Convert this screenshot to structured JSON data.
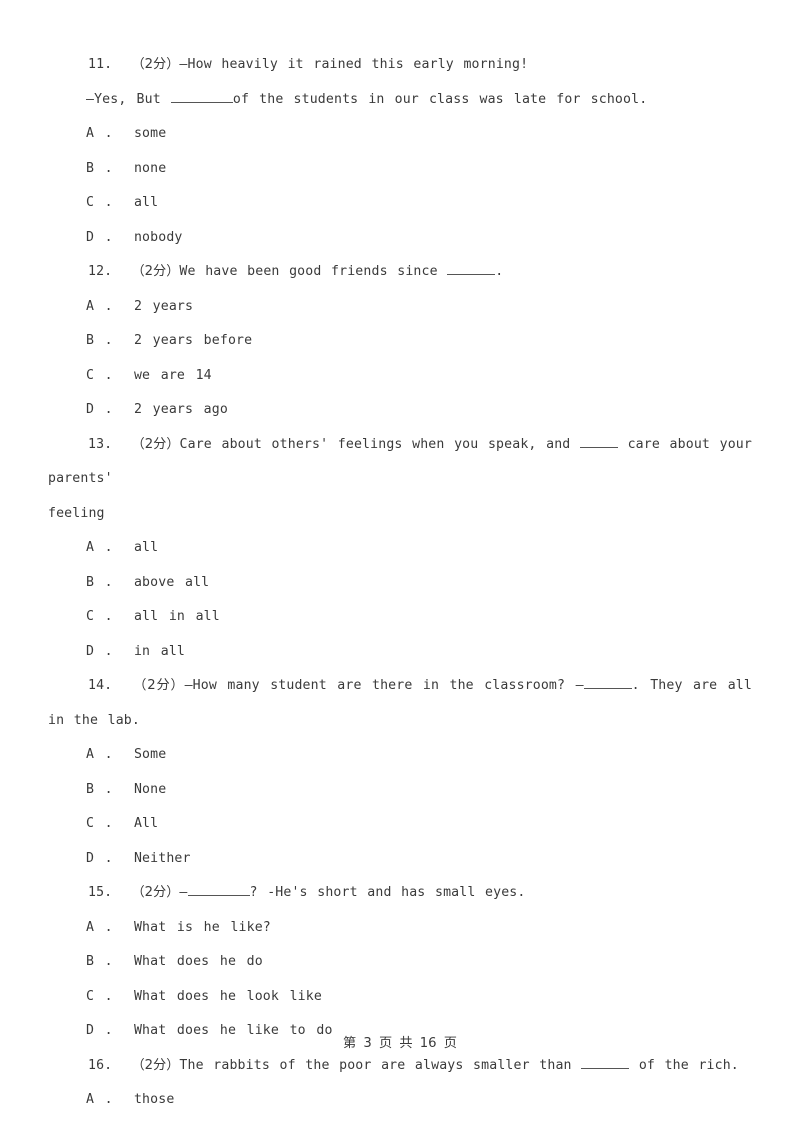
{
  "document": {
    "type": "exam-worksheet",
    "language": "en-zh",
    "score_marker": "（2分）",
    "footer": {
      "text": "第 3 页 共 16 页",
      "prefix": "第",
      "current_page": "3",
      "middle": "页 共",
      "total_pages": "16",
      "suffix": "页"
    }
  },
  "questions": [
    {
      "number": "11.",
      "score": "（2分）",
      "stem": "—How heavily it rained this early morning!",
      "reply_prefix": "—Yes, But ",
      "reply_suffix": "of the students in our class was late for school.",
      "options": [
        {
          "letter": "A",
          "text": "some"
        },
        {
          "letter": "B",
          "text": "none"
        },
        {
          "letter": "C",
          "text": "all"
        },
        {
          "letter": "D",
          "text": "nobody"
        }
      ]
    },
    {
      "number": "12.",
      "score": "（2分）",
      "stem_prefix": "We have been good friends since ",
      "stem_suffix": ".",
      "options": [
        {
          "letter": "A",
          "text": "2 years"
        },
        {
          "letter": "B",
          "text": "2 years before"
        },
        {
          "letter": "C",
          "text": "we are 14"
        },
        {
          "letter": "D",
          "text": "2 years ago"
        }
      ]
    },
    {
      "number": "13.",
      "score": "（2分）",
      "stem_prefix": "Care about others' feelings when you speak, and ",
      "stem_suffix": " care about your parents'",
      "stem_continuation": "feeling",
      "options": [
        {
          "letter": "A",
          "text": "all"
        },
        {
          "letter": "B",
          "text": "above all"
        },
        {
          "letter": "C",
          "text": "all in all"
        },
        {
          "letter": "D",
          "text": "in all"
        }
      ]
    },
    {
      "number": "14.",
      "score": "（2分）",
      "stem_prefix": "—How many student are there in the classroom? —",
      "stem_suffix": ". They are all in the lab.",
      "options": [
        {
          "letter": "A",
          "text": "Some"
        },
        {
          "letter": "B",
          "text": "None"
        },
        {
          "letter": "C",
          "text": "All"
        },
        {
          "letter": "D",
          "text": "Neither"
        }
      ]
    },
    {
      "number": "15.",
      "score": "（2分）",
      "stem_prefix": "—",
      "stem_suffix": "? -He's short and has small eyes.",
      "options": [
        {
          "letter": "A",
          "text": "What is he like?"
        },
        {
          "letter": "B",
          "text": "What does he do"
        },
        {
          "letter": "C",
          "text": "What does he look like"
        },
        {
          "letter": "D",
          "text": "What does he like to do"
        }
      ]
    },
    {
      "number": "16.",
      "score": "（2分）",
      "stem_prefix": "The rabbits of the poor are always smaller than ",
      "stem_suffix": " of the rich.",
      "options": [
        {
          "letter": "A",
          "text": "those"
        }
      ]
    }
  ],
  "labels": {
    "option_separator": " ."
  }
}
